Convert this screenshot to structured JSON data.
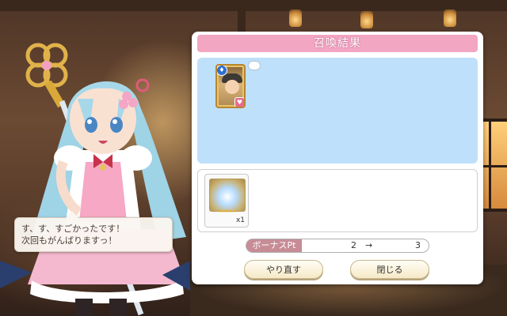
{
  "dialog": {
    "line1": "す、す、すごかったです！",
    "line2": "次回もがんばりますっ！"
  },
  "panel": {
    "title": "召喚結果"
  },
  "result": {
    "card_attribute_glyph": "♦",
    "card_heart_glyph": "♥"
  },
  "bonus_item": {
    "stars": "★★★★★",
    "count": "x1"
  },
  "bonus_pt": {
    "label": "ボーナスPt",
    "from": "2",
    "arrow": "→",
    "to": "3"
  },
  "buttons": {
    "retry": "やり直す",
    "close": "閉じる"
  },
  "colors": {
    "title_bar": "#f2a6c2",
    "result_area": "#bfe0fb",
    "pt_label": "#c78c95",
    "button_face": "#f6e9c6"
  }
}
